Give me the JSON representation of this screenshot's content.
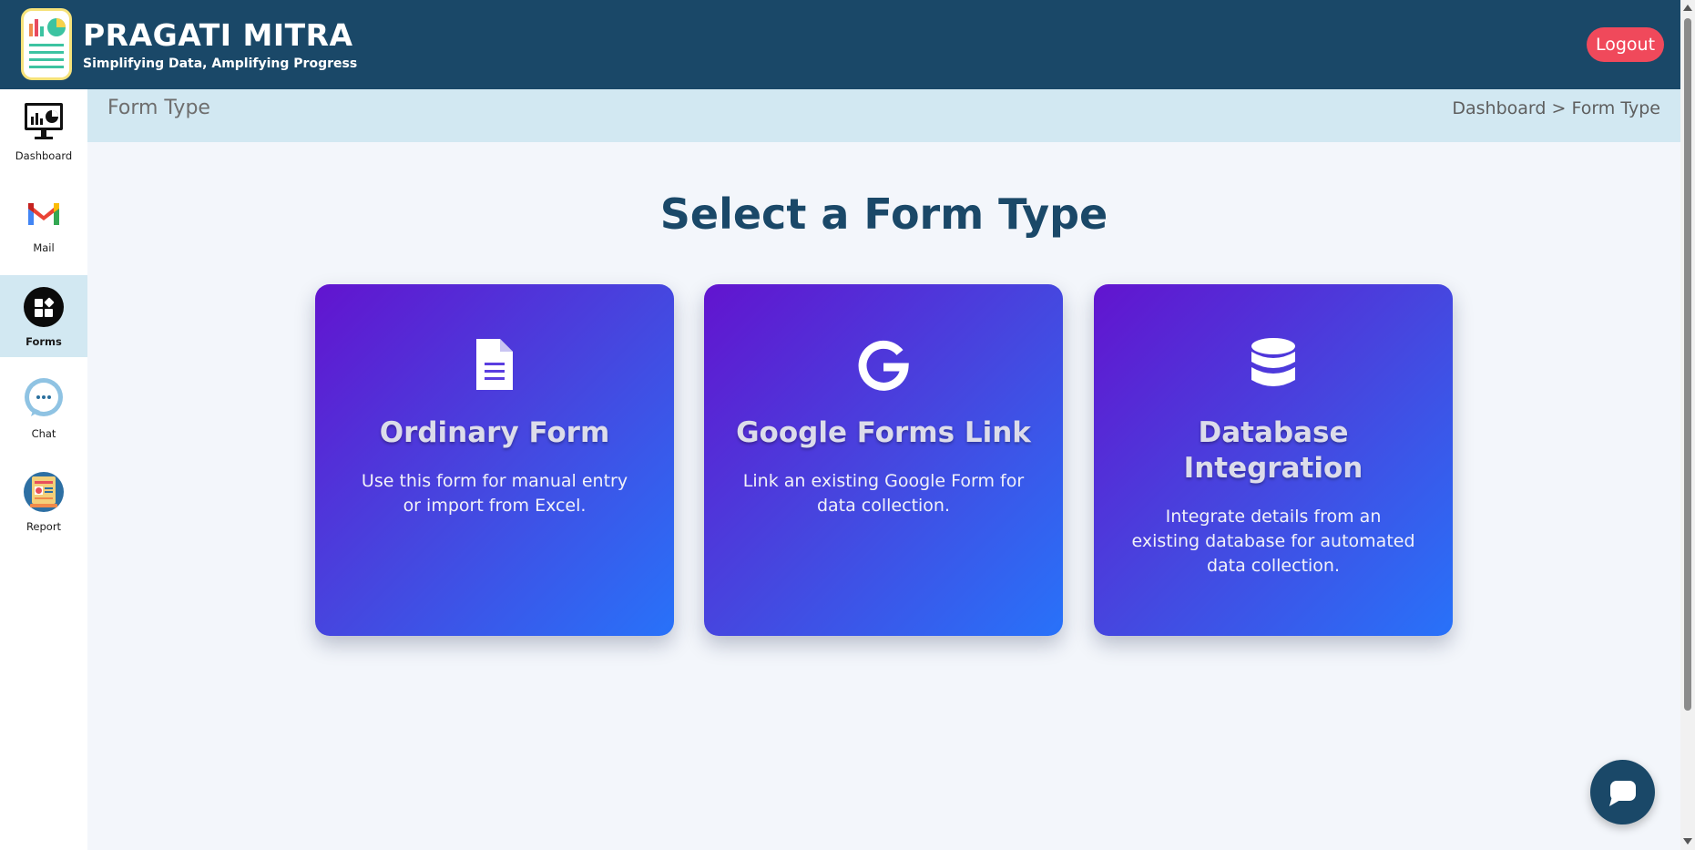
{
  "app": {
    "brand_title": "PRAGATI MITRA",
    "brand_tagline": "Simplifying Data, Amplifying Progress",
    "logout_label": "Logout"
  },
  "sidebar": {
    "items": [
      {
        "label": "Dashboard",
        "icon": "dashboard-chart-icon",
        "active": false
      },
      {
        "label": "Mail",
        "icon": "gmail-icon",
        "active": false
      },
      {
        "label": "Forms",
        "icon": "forms-grid-icon",
        "active": true
      },
      {
        "label": "Chat",
        "icon": "chat-bubble-icon",
        "active": false
      },
      {
        "label": "Report",
        "icon": "report-icon",
        "active": false
      }
    ]
  },
  "subheader": {
    "page_title": "Form Type",
    "breadcrumb": "Dashboard > Form Type"
  },
  "main": {
    "heading": "Select a Form Type",
    "cards": [
      {
        "title": "Ordinary Form",
        "description": "Use this form for manual entry or import from Excel.",
        "icon": "document-icon"
      },
      {
        "title": "Google Forms Link",
        "description": "Link an existing Google Form for data collection.",
        "icon": "google-icon"
      },
      {
        "title": "Database Integration",
        "description": "Integrate details from an existing database for automated data collection.",
        "icon": "database-icon"
      }
    ]
  },
  "colors": {
    "header_bg": "#1a4868",
    "logout_bg": "#f0495b",
    "subheader_bg": "#d2e8f2",
    "card_gradient_start": "#6214cf",
    "card_gradient_end": "#2872f9",
    "heading_color": "#1a4868"
  },
  "chat_fab_icon": "chat-icon"
}
